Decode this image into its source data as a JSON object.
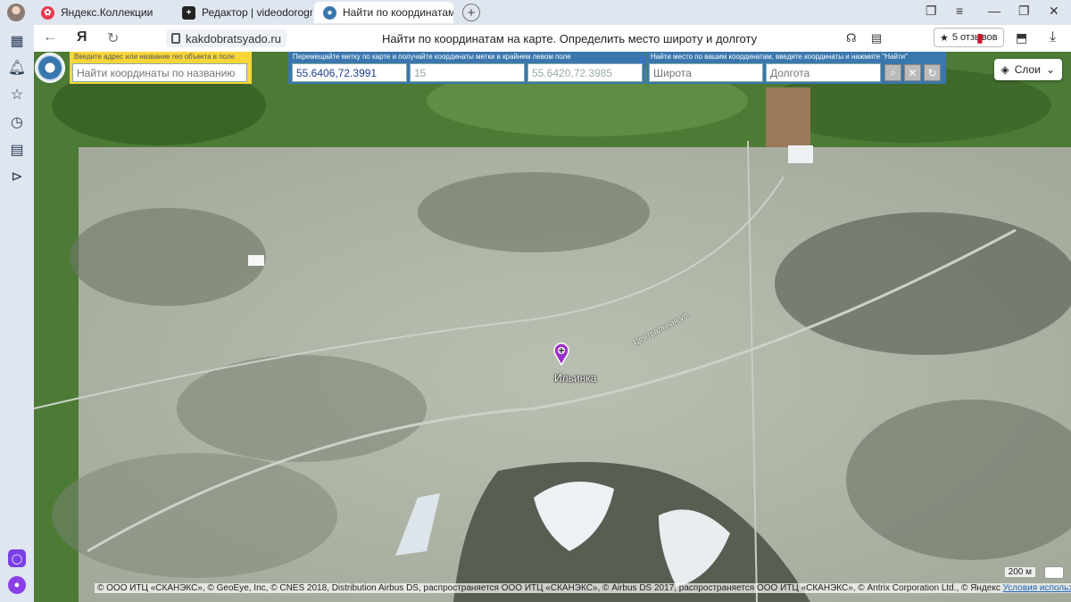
{
  "tabs": [
    {
      "label": "Яндекс.Коллекции"
    },
    {
      "label": "Редактор | videodorogrosi"
    },
    {
      "label": "Найти по координатам н"
    }
  ],
  "address": {
    "url": "kakdobratsyado.ru",
    "page_title": "Найти по координатам на карте. Определить место широту и долготу",
    "reviews": "5 отзывов"
  },
  "search": {
    "hint": "Введите адрес или название гео объекта в поле",
    "placeholder": "Найти координаты по названию"
  },
  "marker_panel": {
    "hint": "Перемещайте метку по карте и получайте координаты метки в крайнем левом поле",
    "coords": "55.6406,72.3991",
    "zoom": "15",
    "corner": "55.6420,72.3985"
  },
  "find_panel": {
    "hint": "Найти место по вашим координатам, введите координаты и нажмите \"Найти\"",
    "lat_placeholder": "Широта",
    "lon_placeholder": "Долгота"
  },
  "map": {
    "layers_label": "Слои",
    "place_label": "Ильинка",
    "street_label": "Центральная ул.",
    "scale": "200 м",
    "copyright": "© ООО ИТЦ «СКАНЭКС», © GeoEye, Inc, © CNES 2018, Distribution Airbus DS, распространяется ООО ИТЦ «СКАНЭКС», © Airbus DS 2017, распространяется ООО ИТЦ «СКАНЭКС», © Antrix Corporation Ltd., © Яндекс",
    "terms": "Условия использования"
  },
  "colors": {
    "panel": "#3a77ad",
    "search_box": "#f7d63a",
    "marker": "#9b2fc9"
  }
}
